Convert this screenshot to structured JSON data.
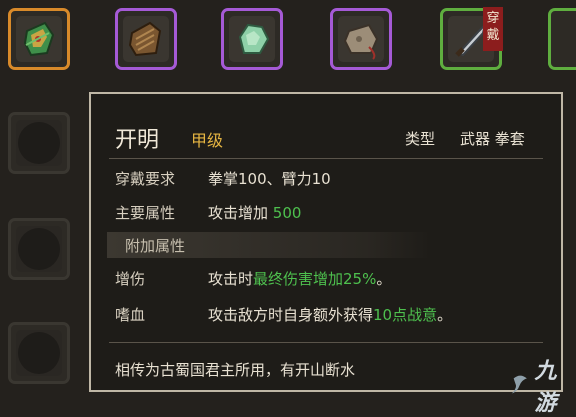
{
  "inventory": {
    "slots": [
      {
        "rarity": "orange",
        "icon": "green-fist-gauntlet-icon"
      },
      {
        "rarity": "purple",
        "icon": "brown-leather-gauntlet-icon"
      },
      {
        "rarity": "purple",
        "icon": "jade-stone-icon"
      },
      {
        "rarity": "purple",
        "icon": "cloth-pouch-icon"
      },
      {
        "rarity": "green",
        "icon": "dagger-icon",
        "badge": "穿戴"
      },
      {
        "rarity": "green",
        "icon": "partial-item-icon"
      }
    ]
  },
  "tooltip": {
    "name": "开明",
    "grade": "甲级",
    "type_label": "类型",
    "type_value": "武器 拳套",
    "requirement_label": "穿戴要求",
    "requirement_value": "拳掌100、臂力10",
    "main_attr_label": "主要属性",
    "main_attr_text": "攻击增加",
    "main_attr_value": "500",
    "section_title": "附加属性",
    "bonus1_label": "增伤",
    "bonus1_prefix": "攻击时",
    "bonus1_highlight": "最终伤害增加25%",
    "bonus1_suffix": "。",
    "bonus2_label": "嗜血",
    "bonus2_prefix": "攻击敌方时自身额外获得",
    "bonus2_highlight": "10点战意",
    "bonus2_suffix": "。",
    "lore": "相传为古蜀国君主所用，有开山断水"
  },
  "watermark": {
    "text": "九游"
  },
  "colors": {
    "orange_rarity": "#d88a2a",
    "purple_rarity": "#a55ad6",
    "green_rarity": "#5fae3f",
    "grade_gold": "#e6b542",
    "highlight_green": "#4ec04e"
  }
}
